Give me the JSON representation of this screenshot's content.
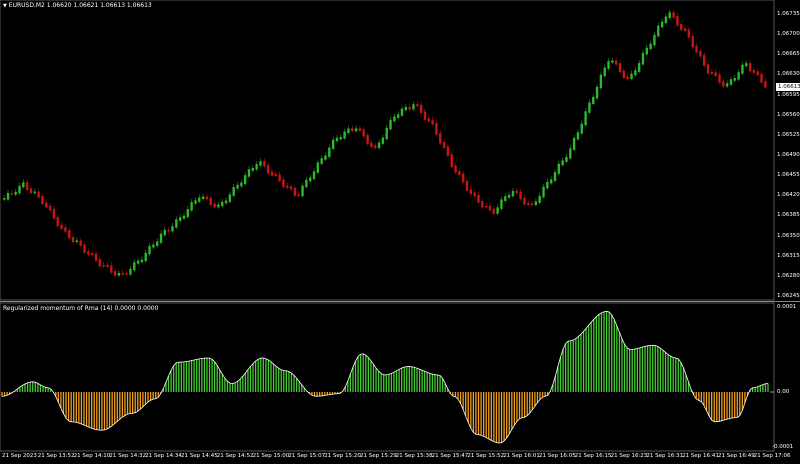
{
  "main_chart": {
    "header_text": "EURUSD,M2  1.06620 1.06621 1.06613 1.06613",
    "menu_icon": "triangle-down-icon",
    "current_price": "1.06613",
    "price_labels": [
      "1.06735",
      "1.06700",
      "1.06665",
      "1.06630",
      "1.06595",
      "1.06560",
      "1.06525",
      "1.06490",
      "1.06455",
      "1.06420",
      "1.06385",
      "1.06350",
      "1.06315",
      "1.06280",
      "1.06245"
    ],
    "up_color": "#2db82d",
    "down_color": "#c81414"
  },
  "indicator": {
    "header_text": "Regularized momentum of Rma (14) 0.0000 0.0000",
    "labels": [
      "0.0001",
      "0.00",
      "-0.0001"
    ],
    "positive_color": "#44cc33",
    "negative_color": "#f0a020",
    "line_color": "#ffffff"
  },
  "time_labels": [
    "21 Sep 2023",
    "21 Sep 13:52",
    "21 Sep 14:10",
    "21 Sep 14:32",
    "21 Sep 14:34",
    "21 Sep 14:45",
    "21 Sep 14:52",
    "21 Sep 15:00",
    "21 Sep 15:07",
    "21 Sep 15:20",
    "21 Sep 15:29",
    "21 Sep 15:38",
    "21 Sep 15:47",
    "21 Sep 15:52",
    "21 Sep 16:01",
    "21 Sep 16:05",
    "21 Sep 16:15",
    "21 Sep 16:23",
    "21 Sep 16:31",
    "21 Sep 16:41",
    "21 Sep 16:49",
    "21 Sep 17:06"
  ],
  "chart_data": [
    {
      "type": "candlestick-renko",
      "title": "EURUSD,M2",
      "series": [
        {
          "name": "EURUSD,M2",
          "values": [
            1.06415,
            1.0644,
            1.0641,
            1.0636,
            1.0633,
            1.063,
            1.0628,
            1.0631,
            1.0635,
            1.0638,
            1.0642,
            1.064,
            1.0644,
            1.0648,
            1.0645,
            1.0642,
            1.0647,
            1.0652,
            1.0654,
            1.065,
            1.0656,
            1.0658,
            1.0654,
            1.0647,
            1.0642,
            1.0639,
            1.0643,
            1.064,
            1.0645,
            1.065,
            1.0658,
            1.0666,
            1.0662,
            1.0668,
            1.0674,
            1.067,
            1.0664,
            1.0661,
            1.0665,
            1.06613
          ]
        }
      ],
      "ylim": [
        1.06245,
        1.06735
      ]
    },
    {
      "type": "bar",
      "title": "Regularized momentum of Rma (14)",
      "ylim": [
        -0.0001,
        0.0001
      ]
    }
  ]
}
